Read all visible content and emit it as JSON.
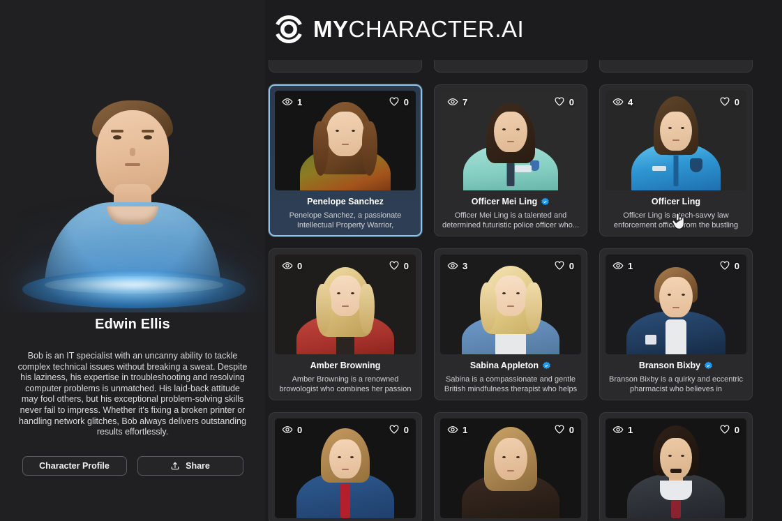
{
  "brand": {
    "logo_icon": "target-rings-icon",
    "name_bold": "MY",
    "name_light": "CHARACTER.AI"
  },
  "character_panel": {
    "avatar_icon": "male-avatar-hologram",
    "name": "Edwin Ellis",
    "bio": "Bob is an IT specialist with an uncanny ability to tackle complex technical issues without breaking a sweat. Despite his laziness, his expertise in troubleshooting and resolving computer problems is unmatched. His laid-back attitude may fool others, but his exceptional problem-solving skills never fail to impress. Whether it's fixing a broken printer or handling network glitches, Bob always delivers outstanding results effortlessly.",
    "buttons": {
      "profile_label": "Character Profile",
      "share_label": "Share",
      "share_icon": "upload-share-icon"
    }
  },
  "grid": {
    "views_icon": "eye-icon",
    "likes_icon": "heart-icon",
    "verified_icon": "verified-badge-icon",
    "cursor_icon": "pointer-hand-cursor",
    "partial_top_row": [
      {
        "id": "partial-1"
      },
      {
        "id": "partial-2"
      },
      {
        "id": "partial-3"
      }
    ],
    "cards": [
      {
        "name": "Penelope Sanchez",
        "description": "Penelope Sanchez, a passionate Intellectual Property Warrior, originates...",
        "views": "1",
        "likes": "0",
        "verified": false,
        "selected": true
      },
      {
        "name": "Officer Mei Ling",
        "description": "Officer Mei Ling is a talented and determined futuristic police officer who...",
        "views": "7",
        "likes": "0",
        "verified": true,
        "selected": false
      },
      {
        "name": "Officer Ling",
        "description": "Officer Ling is a tech-savvy law enforcement officer from the bustling cit...",
        "views": "4",
        "likes": "0",
        "verified": false,
        "selected": false
      },
      {
        "name": "Amber Browning",
        "description": "Amber Browning is a renowned browologist who combines her passion for science an...",
        "views": "0",
        "likes": "0",
        "verified": false,
        "selected": false
      },
      {
        "name": "Sabina Appleton",
        "description": "Sabina is a compassionate and gentle British mindfulness therapist who helps h...",
        "views": "3",
        "likes": "0",
        "verified": true,
        "selected": false
      },
      {
        "name": "Branson Bixby",
        "description": "Branson Bixby is a quirky and eccentric pharmacist who believes in prescribing...",
        "views": "1",
        "likes": "0",
        "verified": true,
        "selected": false
      }
    ],
    "partial_bottom_row": [
      {
        "views": "0",
        "likes": "0"
      },
      {
        "views": "1",
        "likes": "0"
      },
      {
        "views": "1",
        "likes": "0"
      }
    ]
  },
  "colors": {
    "page_background": "#1c1c1e",
    "panel_background": "#202022",
    "card_background": "#2a2a2c",
    "selected_border": "#8fc4ea",
    "selected_background": "#2e3f55",
    "verified_blue": "#1d9bf0",
    "text_primary": "#ffffff",
    "text_secondary": "#cfcfd3"
  }
}
